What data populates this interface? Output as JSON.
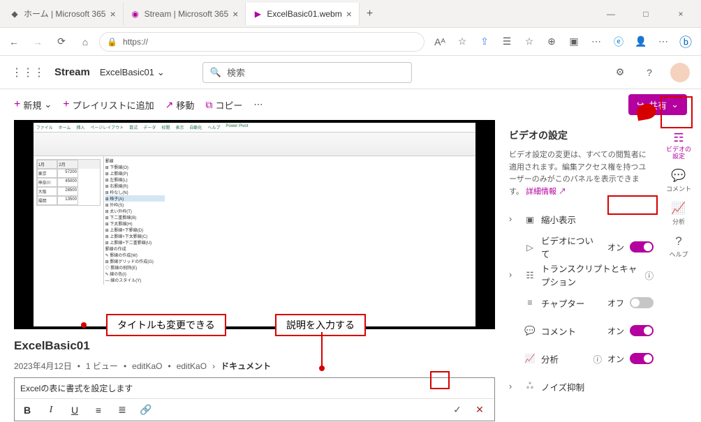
{
  "browser": {
    "tabs": [
      {
        "label": "ホーム | Microsoft 365"
      },
      {
        "label": "Stream | Microsoft 365"
      },
      {
        "label": "ExcelBasic01.webm"
      }
    ],
    "url": "https://"
  },
  "header": {
    "app": "Stream",
    "breadcrumb": "ExcelBasic01",
    "search_placeholder": "検索"
  },
  "commands": {
    "new": "新規",
    "playlist": "プレイリストに追加",
    "move": "移動",
    "copy": "コピー",
    "share": "共有"
  },
  "video": {
    "title": "ExcelBasic01",
    "meta": {
      "date": "2023年4月12日",
      "views": "1 ビュー",
      "author": "editKaO",
      "editor": "editKaO",
      "location": "ドキュメント"
    },
    "description": "Excelの表に書式を設定します"
  },
  "annotations": {
    "title_hint": "タイトルも変更できる",
    "desc_hint": "説明を入力する"
  },
  "settings": {
    "title": "ビデオの設定",
    "description_pre": "ビデオ設定の変更は、すべての閲覧者に適用されます。編集アクセス権を持つユーザーのみがこのパネルを表示できます。",
    "details_link": "詳細情報",
    "rows": {
      "thumbnail": "縮小表示",
      "about": "ビデオについて",
      "transcript": "トランスクリプトとキャプション",
      "chapters": "チャプター",
      "comments": "コメント",
      "analytics": "分析",
      "noise": "ノイズ抑制"
    },
    "toggle_on": "オン",
    "toggle_off": "オフ"
  },
  "rail": {
    "settings": "ビデオの設定",
    "comments": "コメント",
    "analytics": "分析",
    "help": "ヘルプ"
  }
}
